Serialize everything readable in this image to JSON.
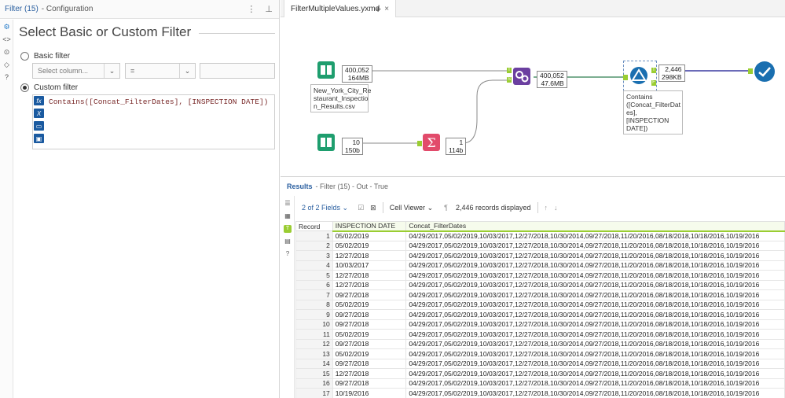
{
  "config_panel": {
    "title": "Filter (15)",
    "subtitle": "- Configuration",
    "heading": "Select Basic or Custom Filter",
    "basic_filter_label": "Basic filter",
    "select_column_placeholder": "Select column...",
    "operator_value": "=",
    "value_input": "",
    "custom_filter_label": "Custom filter",
    "expression": "Contains([Concat_FilterDates], [INSPECTION DATE])"
  },
  "tabs": [
    {
      "label": "FilterMultipleValues.yxmd"
    }
  ],
  "canvas": {
    "input1_badge": [
      "400,052",
      "164MB"
    ],
    "input1_label": "New_York_City_Re\nstaurant_Inspectio\nn_Results.csv",
    "input2_badge": [
      "10",
      "150b"
    ],
    "summarize_badge": [
      "1",
      "114b"
    ],
    "append_badge": [
      "400,052",
      "47.6MB"
    ],
    "filter_badge": [
      "2,446",
      "298KB"
    ],
    "filter_label": "Contains\n([Concat_FilterDat\nes], [INSPECTION\nDATE])"
  },
  "results": {
    "title": "Results",
    "crumb": "- Filter (15) - Out - True",
    "fields_label": "2 of 2 Fields",
    "cell_viewer_label": "Cell Viewer",
    "records_label": "2,446 records displayed",
    "columns": [
      "Record",
      "INSPECTION DATE",
      "Concat_FilterDates"
    ],
    "concat_value": "04/29/2017,05/02/2019,10/03/2017,12/27/2018,10/30/2014,09/27/2018,11/20/2016,08/18/2018,10/18/2016,10/19/2016",
    "rows": [
      [
        "1",
        "05/02/2019"
      ],
      [
        "2",
        "05/02/2019"
      ],
      [
        "3",
        "12/27/2018"
      ],
      [
        "4",
        "10/03/2017"
      ],
      [
        "5",
        "12/27/2018"
      ],
      [
        "6",
        "12/27/2018"
      ],
      [
        "7",
        "09/27/2018"
      ],
      [
        "8",
        "05/02/2019"
      ],
      [
        "9",
        "09/27/2018"
      ],
      [
        "10",
        "09/27/2018"
      ],
      [
        "11",
        "05/02/2019"
      ],
      [
        "12",
        "09/27/2018"
      ],
      [
        "13",
        "05/02/2019"
      ],
      [
        "14",
        "09/27/2018"
      ],
      [
        "15",
        "12/27/2018"
      ],
      [
        "16",
        "09/27/2018"
      ],
      [
        "17",
        "10/19/2016"
      ]
    ]
  },
  "colors": {
    "accent": "#1f77c8",
    "input_tool": "#1e9e6e",
    "summarize_tool": "#e24b6b",
    "append_tool": "#6b3fa0",
    "filter_tool": "#1a6fb0",
    "browse_tool": "#1a6fb0",
    "true_anchor": "#9acd32"
  }
}
